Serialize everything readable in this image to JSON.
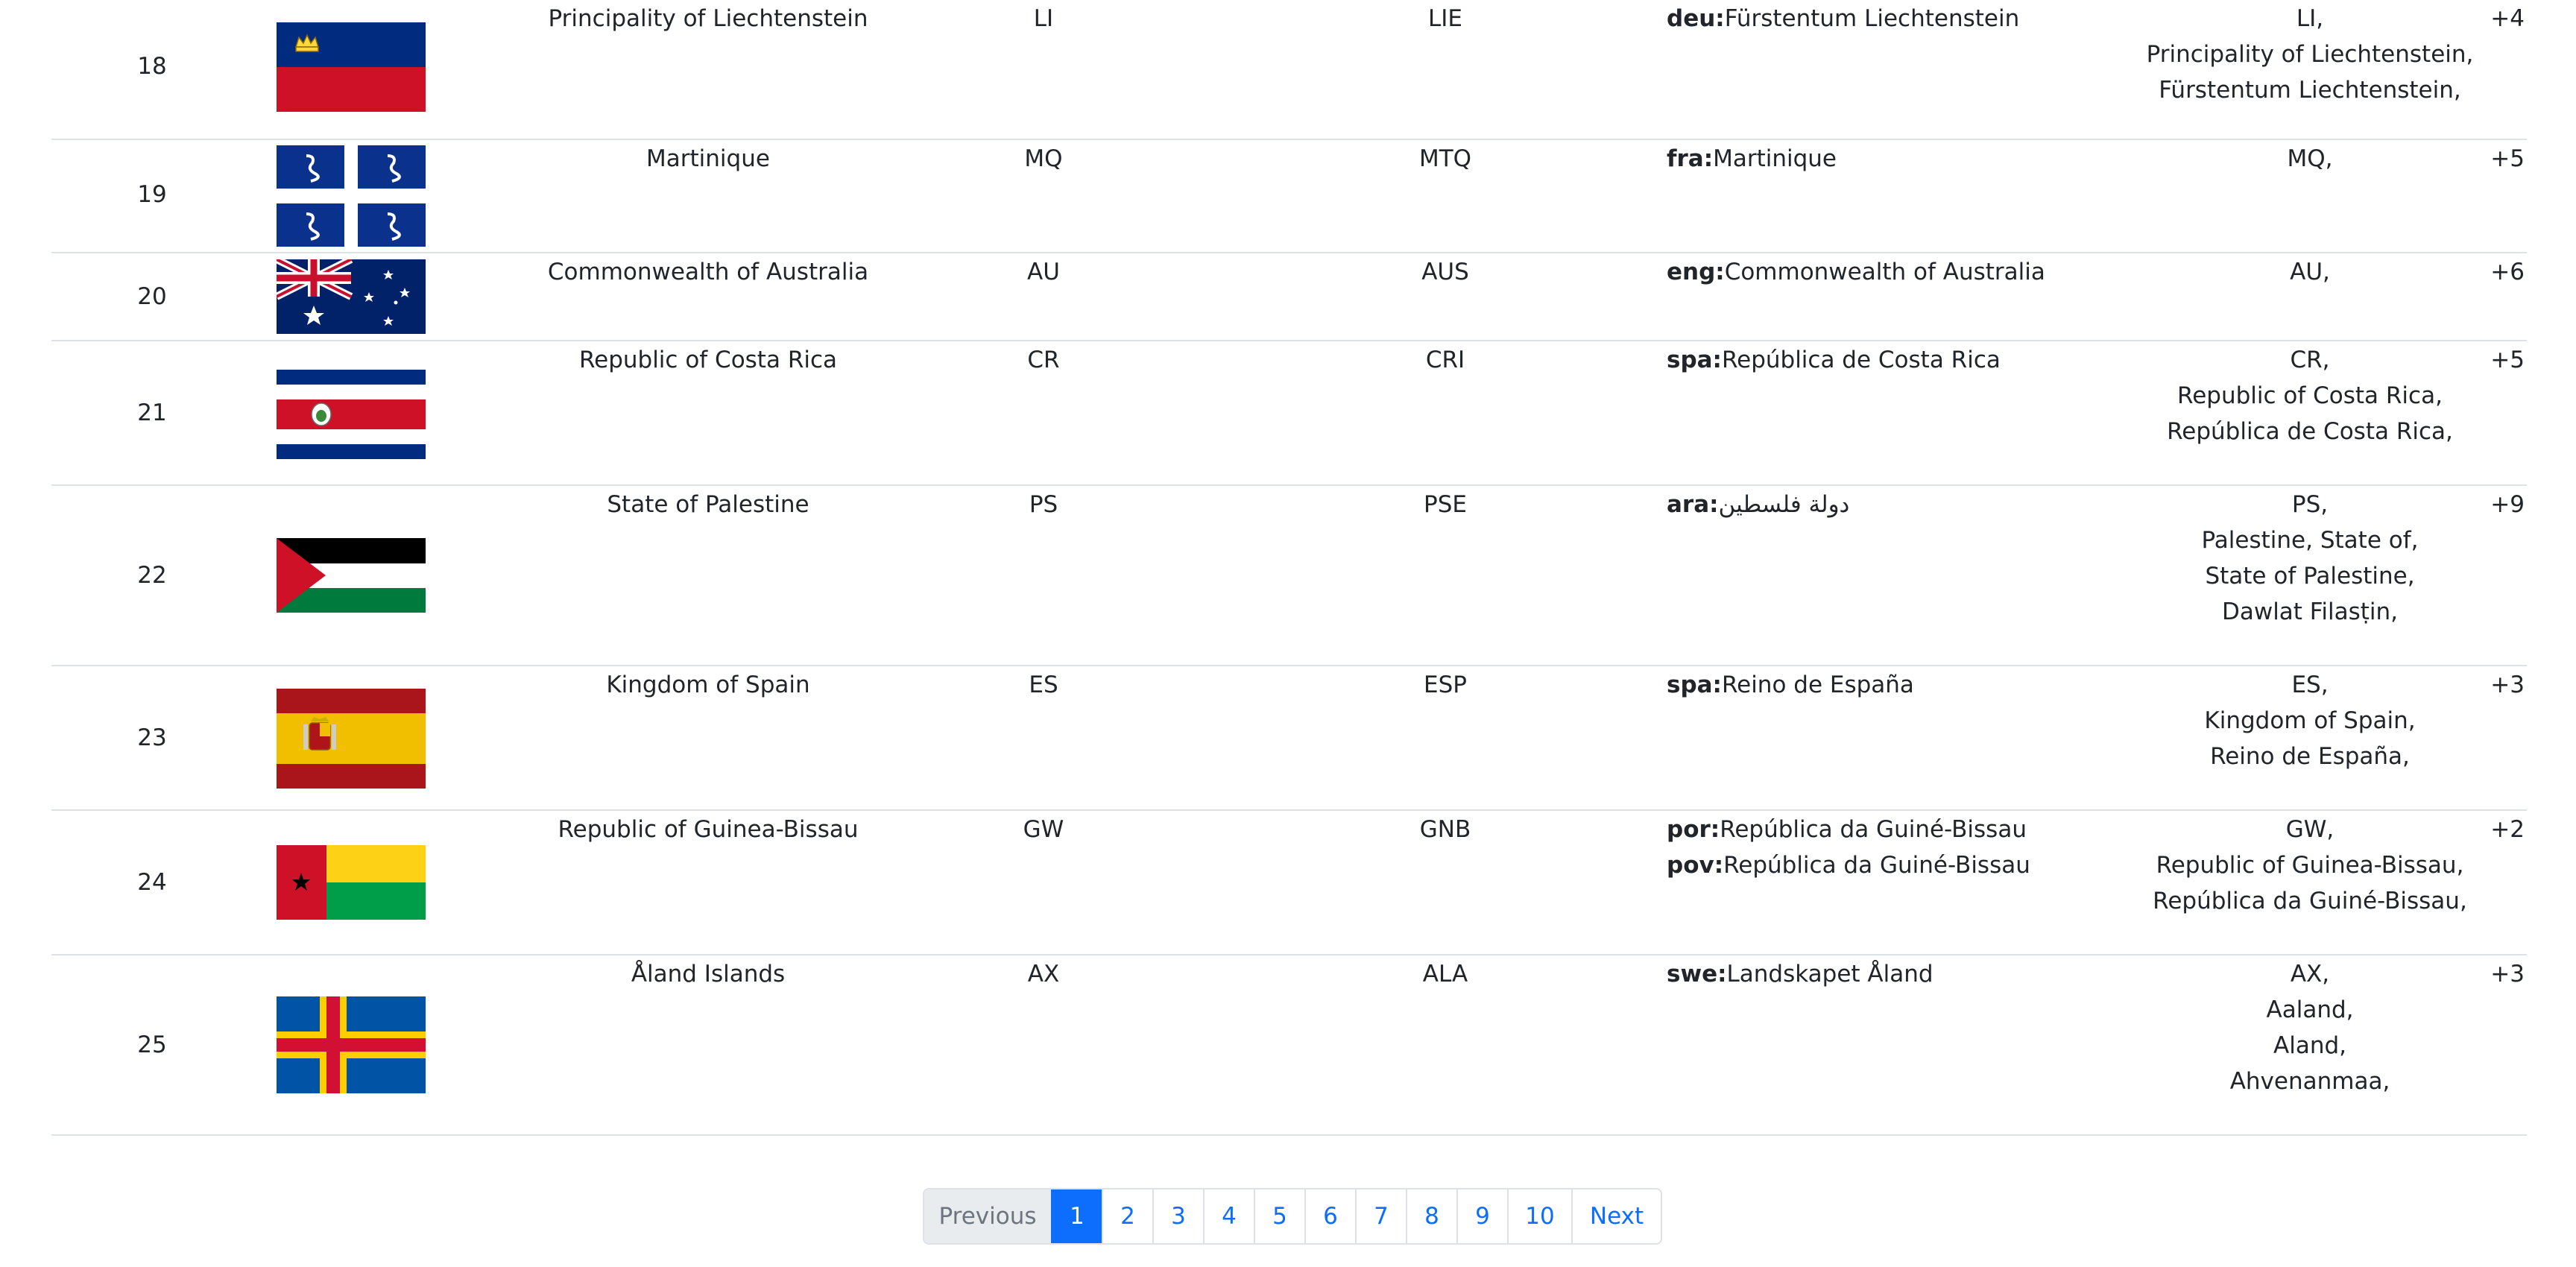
{
  "rows": [
    {
      "idx": "18",
      "name": "Principality of Liechtenstein",
      "cca2": "LI",
      "cca3": "LIE",
      "native": [
        {
          "lang": "deu:",
          "text": "Fürstentum Liechtenstein"
        }
      ],
      "alt": [
        "LI,",
        "Principality of Liechtenstein,",
        "Fürstentum Liechtenstein,"
      ],
      "more": "+4",
      "flag": "liechtenstein-flag"
    },
    {
      "idx": "19",
      "name": "Martinique",
      "cca2": "MQ",
      "cca3": "MTQ",
      "native": [
        {
          "lang": "fra:",
          "text": "Martinique"
        }
      ],
      "alt": [
        "MQ,"
      ],
      "more": "+5",
      "flag": "martinique-flag"
    },
    {
      "idx": "20",
      "name": "Commonwealth of Australia",
      "cca2": "AU",
      "cca3": "AUS",
      "native": [
        {
          "lang": "eng:",
          "text": "Commonwealth of Australia"
        }
      ],
      "alt": [
        "AU,"
      ],
      "more": "+6",
      "flag": "australia-flag"
    },
    {
      "idx": "21",
      "name": "Republic of Costa Rica",
      "cca2": "CR",
      "cca3": "CRI",
      "native": [
        {
          "lang": "spa:",
          "text": "República de Costa Rica"
        }
      ],
      "alt": [
        "CR,",
        "Republic of Costa Rica,",
        "República de Costa Rica,"
      ],
      "more": "+5",
      "flag": "costa-rica-flag"
    },
    {
      "idx": "22",
      "name": "State of Palestine",
      "cca2": "PS",
      "cca3": "PSE",
      "native": [
        {
          "lang": "ara:",
          "text": "دولة فلسطين"
        }
      ],
      "alt": [
        "PS,",
        "Palestine, State of,",
        "State of Palestine,",
        "Dawlat Filasṭin,"
      ],
      "more": "+9",
      "flag": "palestine-flag"
    },
    {
      "idx": "23",
      "name": "Kingdom of Spain",
      "cca2": "ES",
      "cca3": "ESP",
      "native": [
        {
          "lang": "spa:",
          "text": "Reino de España"
        }
      ],
      "alt": [
        "ES,",
        "Kingdom of Spain,",
        "Reino de España,"
      ],
      "more": "+3",
      "flag": "spain-flag"
    },
    {
      "idx": "24",
      "name": "Republic of Guinea-Bissau",
      "cca2": "GW",
      "cca3": "GNB",
      "native": [
        {
          "lang": "por:",
          "text": "República da Guiné-Bissau"
        },
        {
          "lang": "pov:",
          "text": "República da Guiné-Bissau"
        }
      ],
      "alt": [
        "GW,",
        "Republic of Guinea-Bissau,",
        "República da Guiné-Bissau,"
      ],
      "more": "+2",
      "flag": "guinea-bissau-flag"
    },
    {
      "idx": "25",
      "name": "Åland Islands",
      "cca2": "AX",
      "cca3": "ALA",
      "native": [
        {
          "lang": "swe:",
          "text": "Landskapet Åland"
        }
      ],
      "alt": [
        "AX,",
        "Aaland,",
        "Aland,",
        "Ahvenanmaa,"
      ],
      "more": "+3",
      "flag": "aland-flag"
    }
  ],
  "pagination": {
    "previous": "Previous",
    "pages": [
      "1",
      "2",
      "3",
      "4",
      "5",
      "6",
      "7",
      "8",
      "9",
      "10"
    ],
    "active": "1",
    "next": "Next"
  },
  "colors": {
    "accent": "#0d6efd",
    "border": "#dee2e6",
    "text": "#212529"
  }
}
